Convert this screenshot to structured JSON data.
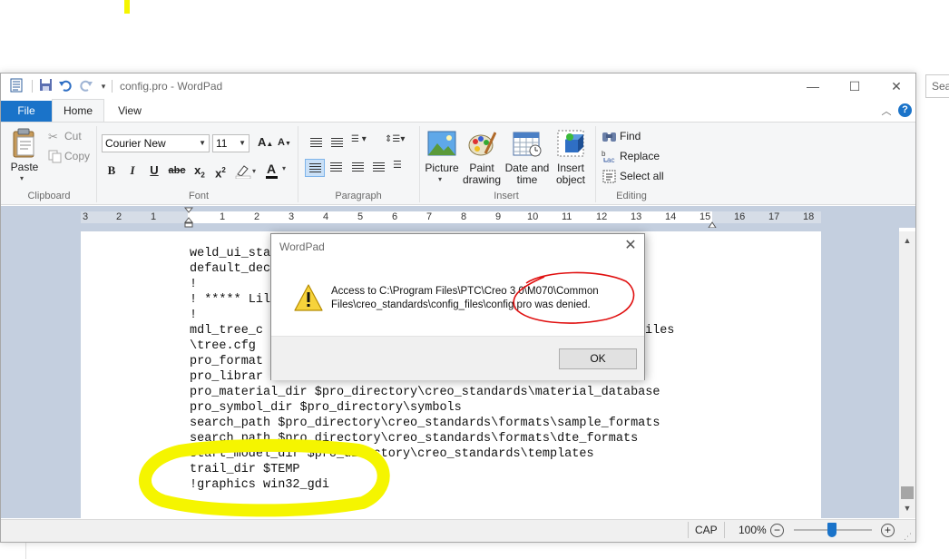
{
  "app": {
    "window_title": "config.pro - WordPad",
    "search_stub": "Sea"
  },
  "tabs": [
    "File",
    "Home",
    "View"
  ],
  "ribbon": {
    "clipboard": {
      "label": "Clipboard",
      "paste": "Paste",
      "cut": "Cut",
      "copy": "Copy"
    },
    "font": {
      "label": "Font",
      "family": "Courier New",
      "size": "11",
      "grow": "A",
      "shrink": "A",
      "bold": "B",
      "italic": "I",
      "underline": "U",
      "strike": "abc",
      "sub": "x",
      "sup": "x",
      "sub_mark": "2",
      "sup_mark": "2",
      "color_letter": "A"
    },
    "paragraph": {
      "label": "Paragraph"
    },
    "insert": {
      "label": "Insert",
      "picture": "Picture",
      "paint": [
        "Paint",
        "drawing"
      ],
      "datetime": [
        "Date and",
        "time"
      ],
      "object": [
        "Insert",
        "object"
      ]
    },
    "editing": {
      "label": "Editing",
      "find": "Find",
      "replace": "Replace",
      "select_all": "Select all"
    }
  },
  "ruler": {
    "numbers": [
      "3",
      "2",
      "1",
      "1",
      "2",
      "3",
      "4",
      "5",
      "6",
      "7",
      "8",
      "9",
      "10",
      "11",
      "12",
      "13",
      "14",
      "15",
      "16",
      "17",
      "18"
    ]
  },
  "document": {
    "lines": [
      "weld_ui_sta",
      "default_dec",
      "!",
      "! ***** Lil",
      "!",
      "mdl_tree_c",
      "\\tree.cfg",
      "pro_format",
      "pro_librar",
      "pro_material_dir $pro_directory\\creo_standards\\material_database",
      "pro_symbol_dir $pro_directory\\symbols",
      "search_path $pro_directory\\creo_standards\\formats\\sample_formats",
      "search_path $pro_directory\\creo_standards\\formats\\dte_formats",
      "start_model_dir $pro_directory\\creo_standards\\templates",
      "trail_dir $TEMP",
      "!graphics win32_gdi"
    ],
    "tail_fragment": "iles"
  },
  "status": {
    "caps": "CAP",
    "zoom": "100%"
  },
  "dialog": {
    "title": "WordPad",
    "message": "Access to C:\\Program Files\\PTC\\Creo 3.0\\M070\\Common Files\\creo_standards\\config_files\\config.pro was denied.",
    "ok": "OK",
    "icon": "warning-icon"
  },
  "colors": {
    "accent": "#1a73c9",
    "highlight": "#f5f500",
    "annotation_red": "#e01010"
  }
}
